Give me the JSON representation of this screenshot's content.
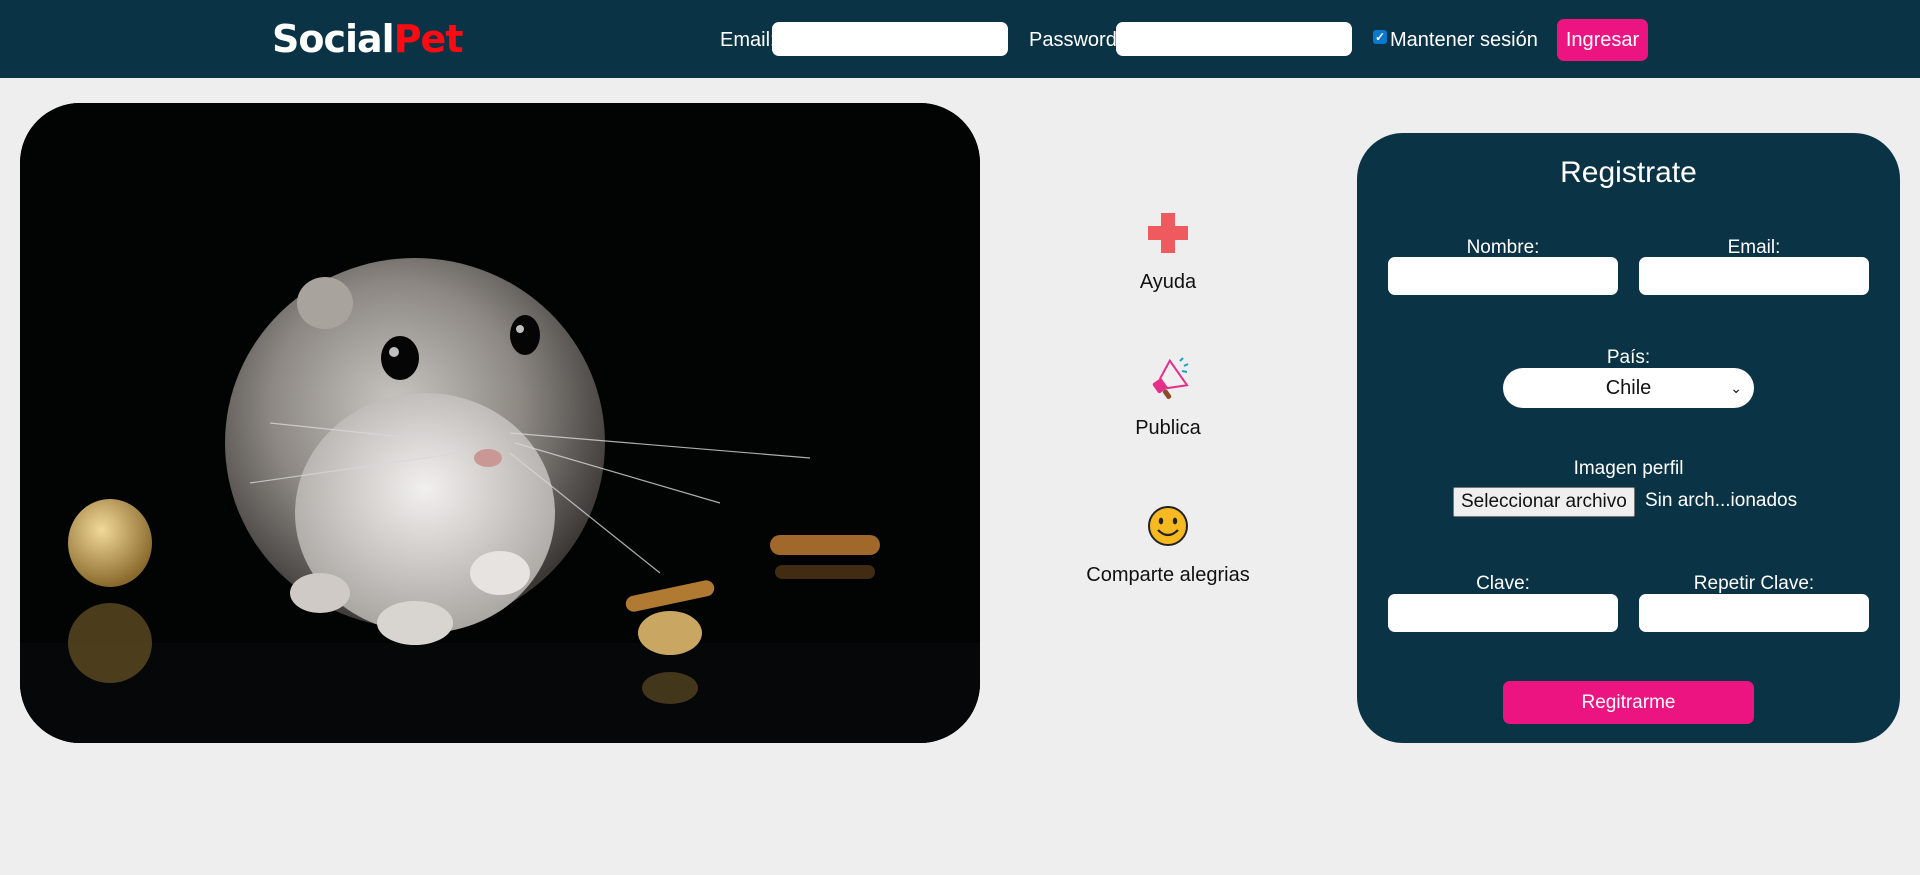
{
  "header": {
    "logo_part1": "Social",
    "logo_part2": "Pet",
    "email_label": "Email:",
    "password_label": "Password:",
    "email_value": "",
    "password_value": "",
    "keep_session_label": "Mantener sesión",
    "keep_session_checked": true,
    "login_button": "Ingresar"
  },
  "features": [
    {
      "label": "Ayuda",
      "icon": "red-cross-icon"
    },
    {
      "label": "Publica",
      "icon": "megaphone-icon"
    },
    {
      "label": "Comparte alegrias",
      "icon": "smiley-icon"
    }
  ],
  "register": {
    "title": "Registrate",
    "name_label": "Nombre:",
    "email_label": "Email:",
    "country_label": "País:",
    "country_selected": "Chile",
    "profile_image_label": "Imagen perfil",
    "file_button": "Seleccionar archivo",
    "file_status": "Sin arch...ionados",
    "password_label": "Clave:",
    "repeat_password_label": "Repetir Clave:",
    "submit_button": "Regitrarme"
  },
  "colors": {
    "header_bg": "#0a3445",
    "accent_pink": "#ec1481",
    "logo_red": "#ff0a12",
    "page_bg": "#eeeeee"
  }
}
